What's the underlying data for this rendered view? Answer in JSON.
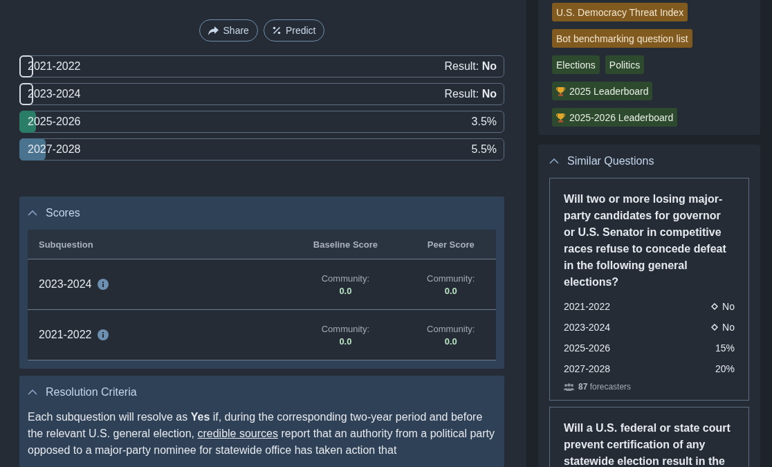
{
  "actions": [
    {
      "kind": "share",
      "label": "Share"
    },
    {
      "kind": "predict",
      "label": "Predict"
    }
  ],
  "subquestions": [
    {
      "label": "2021-2022",
      "kind": "resolved",
      "result_label": "Result:",
      "result": "No"
    },
    {
      "label": "2023-2024",
      "kind": "resolved",
      "result_label": "Result:",
      "result": "No"
    },
    {
      "label": "2025-2026",
      "kind": "open",
      "level": 0.035,
      "color": "#2a7e67",
      "value": "3.5%"
    },
    {
      "label": "2027-2028",
      "kind": "open",
      "level": 0.055,
      "color": "#4a7390",
      "value": "5.5%"
    }
  ],
  "scores": {
    "title": "Scores",
    "expanded": true,
    "columns": [
      "Subquestion",
      "Baseline Score",
      "Peer Score"
    ],
    "rows": [
      {
        "subquestion": "2023-2024",
        "baseline_label": "Community:",
        "baseline": "0.0",
        "peer_label": "Community:",
        "peer": "0.0"
      },
      {
        "subquestion": "2021-2022",
        "baseline_label": "Community:",
        "baseline": "0.0",
        "peer_label": "Community:",
        "peer": "0.0"
      }
    ]
  },
  "resolution": {
    "title": "Resolution Criteria",
    "expanded": true,
    "text_before": "Each subquestion will resolve as **Yes** if, during the corresponding two-year period and before the relevant U.S. general election,",
    "link": "credible sources",
    "text_after": "report that an authority from a political party opposed to a major-party nominee for statewide office has taken action that"
  },
  "tags": [
    {
      "label": "U.S. Democracy Threat Index",
      "kind": "project"
    },
    {
      "label": "Bot benchmarking question list",
      "kind": "project"
    },
    {
      "label": "Elections",
      "kind": "category"
    },
    {
      "label": "Politics",
      "kind": "category"
    },
    {
      "label": "2025 Leaderboard",
      "kind": "leaderboard"
    },
    {
      "label": "2025-2026 Leaderboard",
      "kind": "leaderboard"
    }
  ],
  "similar": {
    "title": "Similar Questions",
    "expanded": true,
    "questions": [
      {
        "title": "Will two or more losing major-party candidates for governor or U.S. Senator in competitive races refuse to concede defeat in the following general elections?",
        "options": [
          {
            "label": "2021-2022",
            "kind": "resolved",
            "value": "No"
          },
          {
            "label": "2023-2024",
            "kind": "resolved",
            "value": "No"
          },
          {
            "label": "2025-2026",
            "kind": "open",
            "value": "15%"
          },
          {
            "label": "2027-2028",
            "kind": "open",
            "value": "20%"
          }
        ],
        "forecasters": "87",
        "forecasters_label": "forecasters"
      },
      {
        "title": "Will a U.S. federal or state court prevent certification of any statewide election result in the"
      }
    ]
  }
}
